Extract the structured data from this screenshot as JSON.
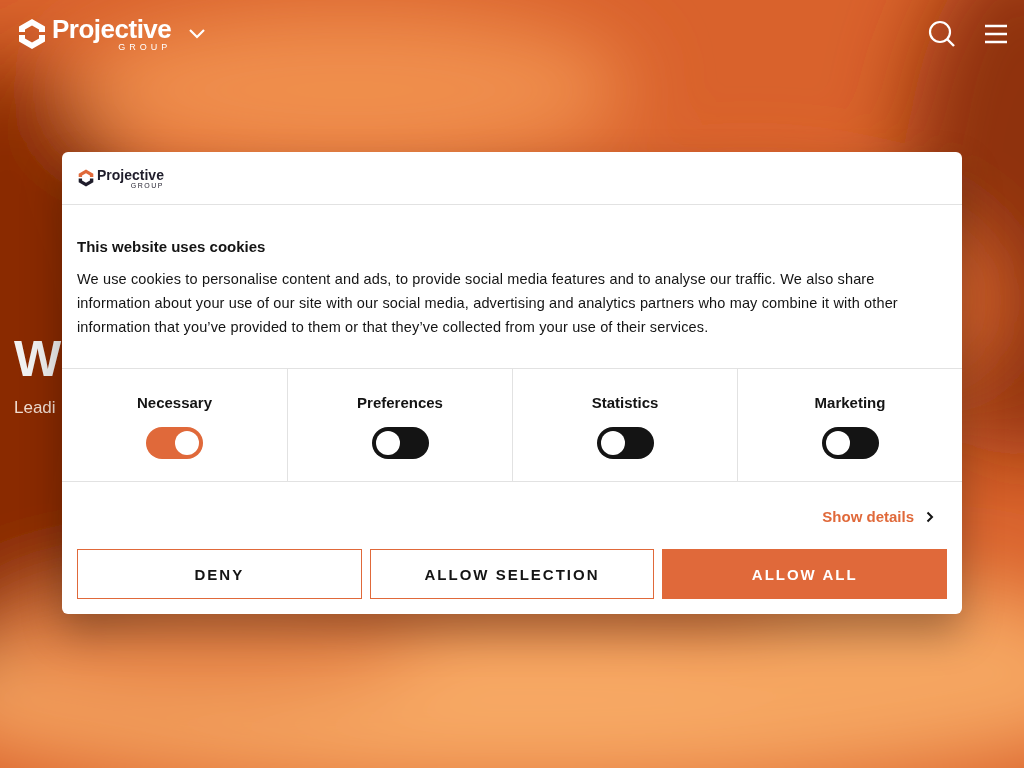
{
  "header": {
    "logo": {
      "name": "Projective",
      "sub": "GROUP"
    }
  },
  "hero": {
    "heading": "W",
    "subheading": "Leadi"
  },
  "dialog": {
    "logo": {
      "name": "Projective",
      "sub": "GROUP"
    },
    "title": "This website uses cookies",
    "body": "We use cookies to personalise content and ads, to provide social media features and to analyse our traffic. We also share information about your use of our site with our social media, advertising and analytics partners who may combine it with other information that you’ve provided to them or that they’ve collected from your use of their services.",
    "categories": [
      {
        "label": "Necessary",
        "checked": true
      },
      {
        "label": "Preferences",
        "checked": false
      },
      {
        "label": "Statistics",
        "checked": false
      },
      {
        "label": "Marketing",
        "checked": false
      }
    ],
    "details_link": "Show details",
    "buttons": [
      {
        "label": "DENY",
        "kind": "outline"
      },
      {
        "label": "ALLOW SELECTION",
        "kind": "outline"
      },
      {
        "label": "ALLOW ALL",
        "kind": "filled"
      }
    ]
  }
}
